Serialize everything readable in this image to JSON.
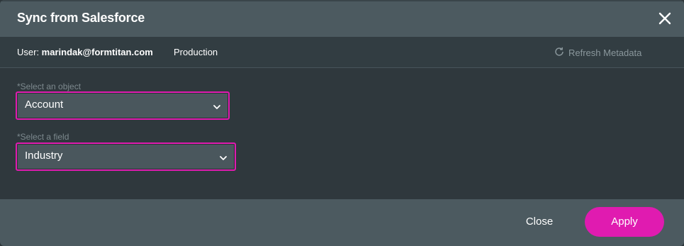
{
  "dialog": {
    "title": "Sync from Salesforce"
  },
  "infobar": {
    "user_prefix": "User: ",
    "user_email": "marindak@formtitan.com",
    "environment": "Production",
    "refresh_label": "Refresh Metadata"
  },
  "form": {
    "object_label": "*Select an object",
    "object_value": "Account",
    "field_label": "*Select a field",
    "field_value": "Industry"
  },
  "footer": {
    "close_label": "Close",
    "apply_label": "Apply"
  },
  "colors": {
    "accent": "#e01bb0",
    "header_bg": "#4c5a60",
    "body_bg": "#2f383d",
    "select_bg": "#4a575d",
    "muted_text": "#7d898e"
  },
  "icons": {
    "close": "close-icon",
    "refresh": "refresh-icon",
    "dropdown": "chevron-down-icon"
  }
}
